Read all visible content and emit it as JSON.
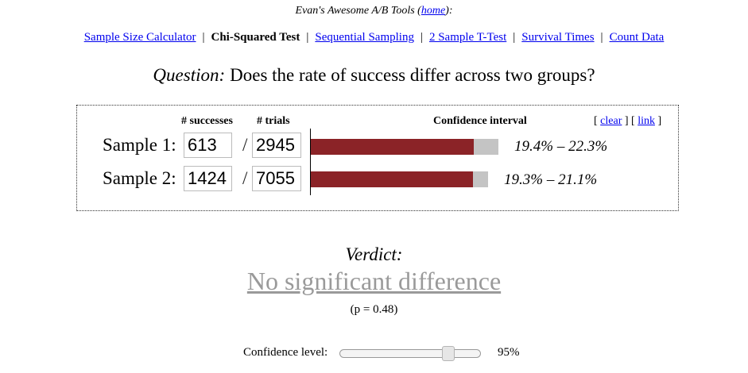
{
  "header": {
    "title": "Evan's Awesome A/B Tools (",
    "home_link": "home",
    "title_suffix": "):"
  },
  "nav": {
    "items": [
      {
        "label": "Sample Size Calculator",
        "current": false
      },
      {
        "label": "Chi-Squared Test",
        "current": true
      },
      {
        "label": "Sequential Sampling",
        "current": false
      },
      {
        "label": "2 Sample T-Test",
        "current": false
      },
      {
        "label": "Survival Times",
        "current": false
      },
      {
        "label": "Count Data",
        "current": false
      }
    ],
    "separator": "|"
  },
  "question": {
    "label": "Question:",
    "text": "Does the rate of success differ across two groups?"
  },
  "panel": {
    "headers": {
      "successes": "# successes",
      "trials": "# trials",
      "ci": "Confidence interval"
    },
    "links": {
      "open1": "[ ",
      "clear": "clear",
      "mid": " ] [ ",
      "link": "link",
      "close": " ]"
    },
    "samples": [
      {
        "label": "Sample 1:",
        "successes": "613",
        "trials": "2945",
        "ci_text": "19.4% – 22.3%",
        "ci_low": 0.194,
        "ci_high": 0.223
      },
      {
        "label": "Sample 2:",
        "successes": "1424",
        "trials": "7055",
        "ci_text": "19.3% – 21.1%",
        "ci_low": 0.193,
        "ci_high": 0.211
      }
    ],
    "slash": "/"
  },
  "verdict": {
    "label": "Verdict:",
    "text": "No significant difference",
    "pvalue": "(p = 0.48)"
  },
  "confidence": {
    "label": "Confidence level:",
    "value_text": "95%",
    "slider_fraction": 0.8
  },
  "colors": {
    "bar_fill": "#8b2327",
    "bar_track": "#c4c4c4",
    "verdict_text": "#9a9a9a",
    "link": "#0000ee"
  }
}
